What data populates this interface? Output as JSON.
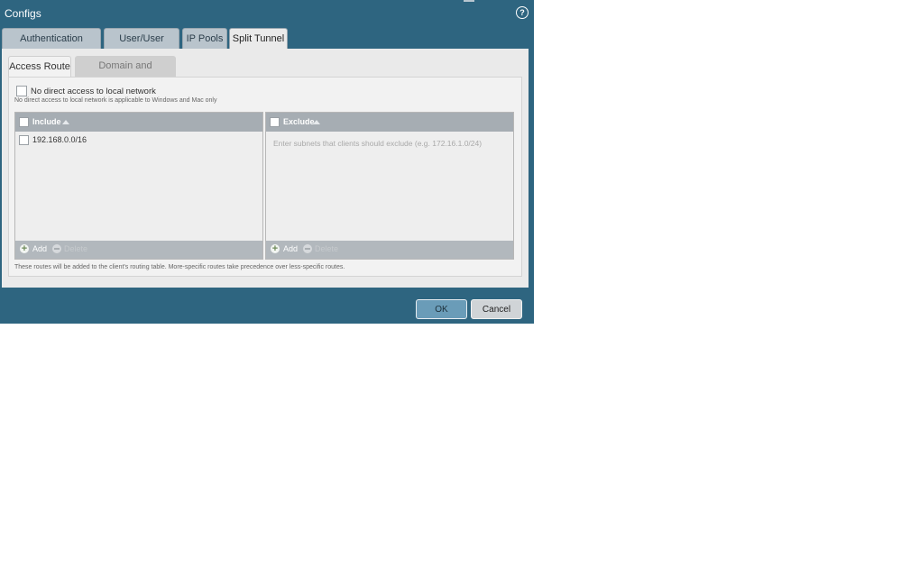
{
  "dialog": {
    "title": "Configs",
    "help_icon": "help-icon",
    "help_glyph": "?",
    "tabs": [
      {
        "label": "Authentication Override"
      },
      {
        "label": "User/User Group"
      },
      {
        "label": "IP Pools"
      },
      {
        "label": "Split Tunnel"
      }
    ],
    "active_tab": "Split Tunnel",
    "subtabs": [
      {
        "label": "Access Route"
      },
      {
        "label": "Domain and Application"
      }
    ],
    "active_subtab": "Access Route"
  },
  "access_route": {
    "no_direct_access": {
      "label": "No direct access to local network",
      "hint": "No direct access to local network is applicable to Windows and Mac only",
      "checked": false
    },
    "include": {
      "header": "Include",
      "rows": [
        {
          "value": "192.168.0.0/16"
        }
      ],
      "add_label": "Add",
      "delete_label": "Delete"
    },
    "exclude": {
      "header": "Exclude",
      "placeholder": "Enter subnets that clients should exclude (e.g. 172.16.1.0/24)",
      "add_label": "Add",
      "delete_label": "Delete"
    },
    "footer_note": "These routes will be added to the client's routing table. More-specific routes take precedence over less-specific routes."
  },
  "buttons": {
    "ok": "OK",
    "cancel": "Cancel"
  },
  "colors": {
    "dialog_bg": "#2e6580",
    "ok_button": "#6a9cb8"
  }
}
